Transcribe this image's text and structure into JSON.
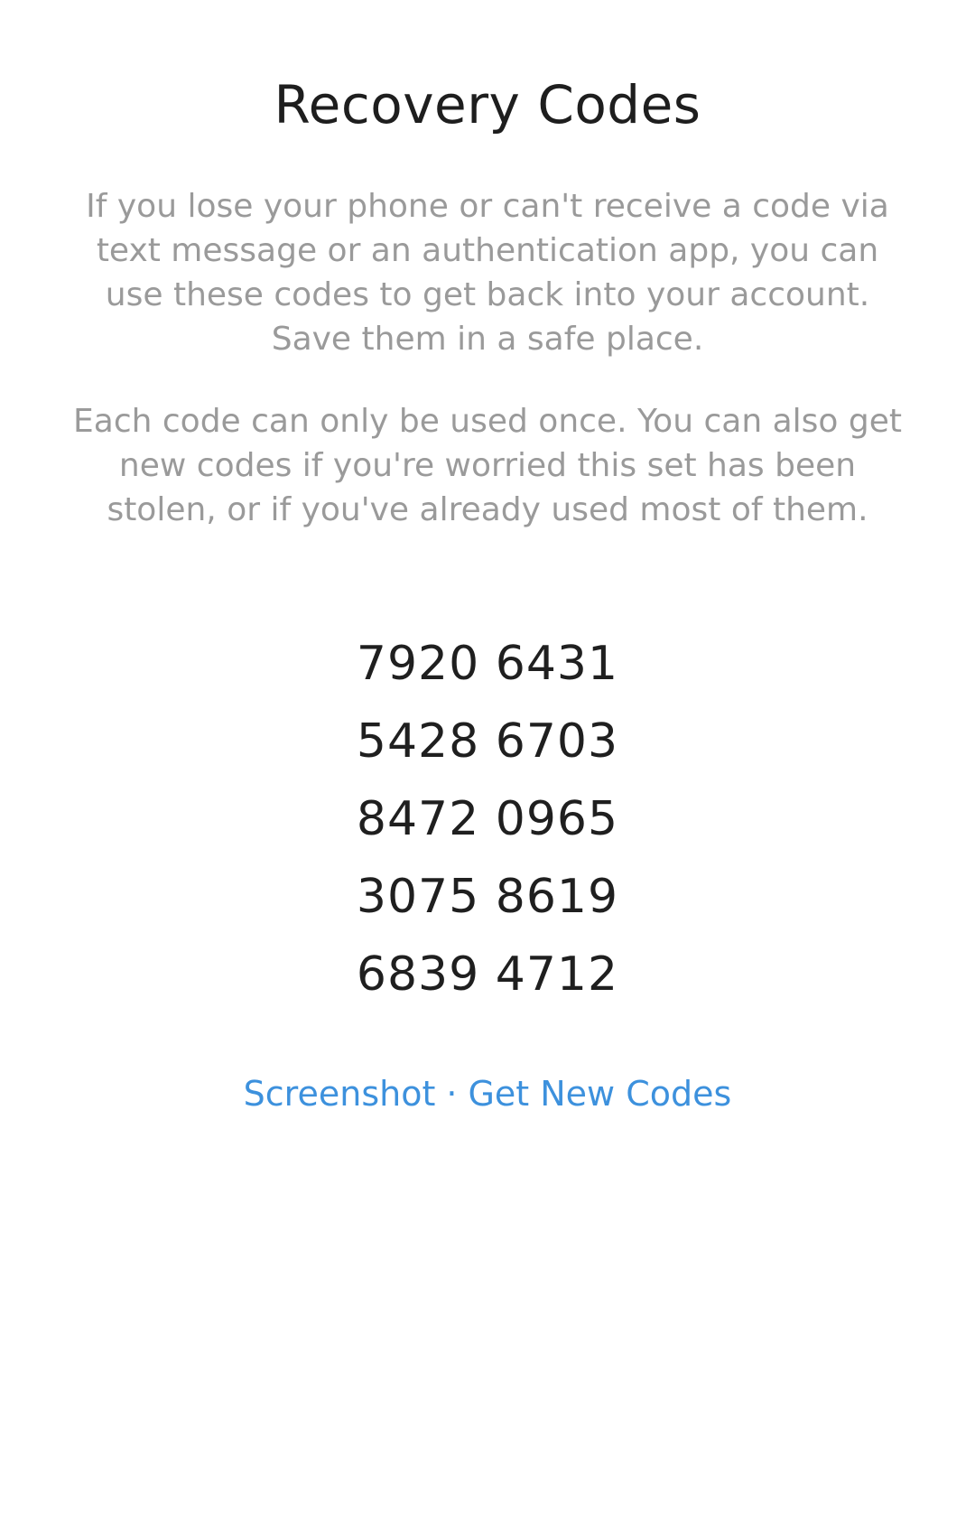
{
  "title": "Recovery Codes",
  "description": {
    "paragraph1": "If you lose your phone or can't receive a code via text message or an authentication app, you can use these codes to get back into your account. Save them in a safe place.",
    "paragraph2": "Each code can only be used once. You can also get new codes if you're worried this set has been stolen, or if you've already used most of them."
  },
  "codes": [
    "7920 6431",
    "5428 6703",
    "8472 0965",
    "3075 8619",
    "6839 4712"
  ],
  "actions": {
    "screenshot_label": "Screenshot",
    "separator": "·",
    "get_new_codes_label": "Get New Codes"
  },
  "colors": {
    "accent": "#3d91dd",
    "body_text": "#9a9a9a",
    "heading_text": "#1e1e1e"
  }
}
